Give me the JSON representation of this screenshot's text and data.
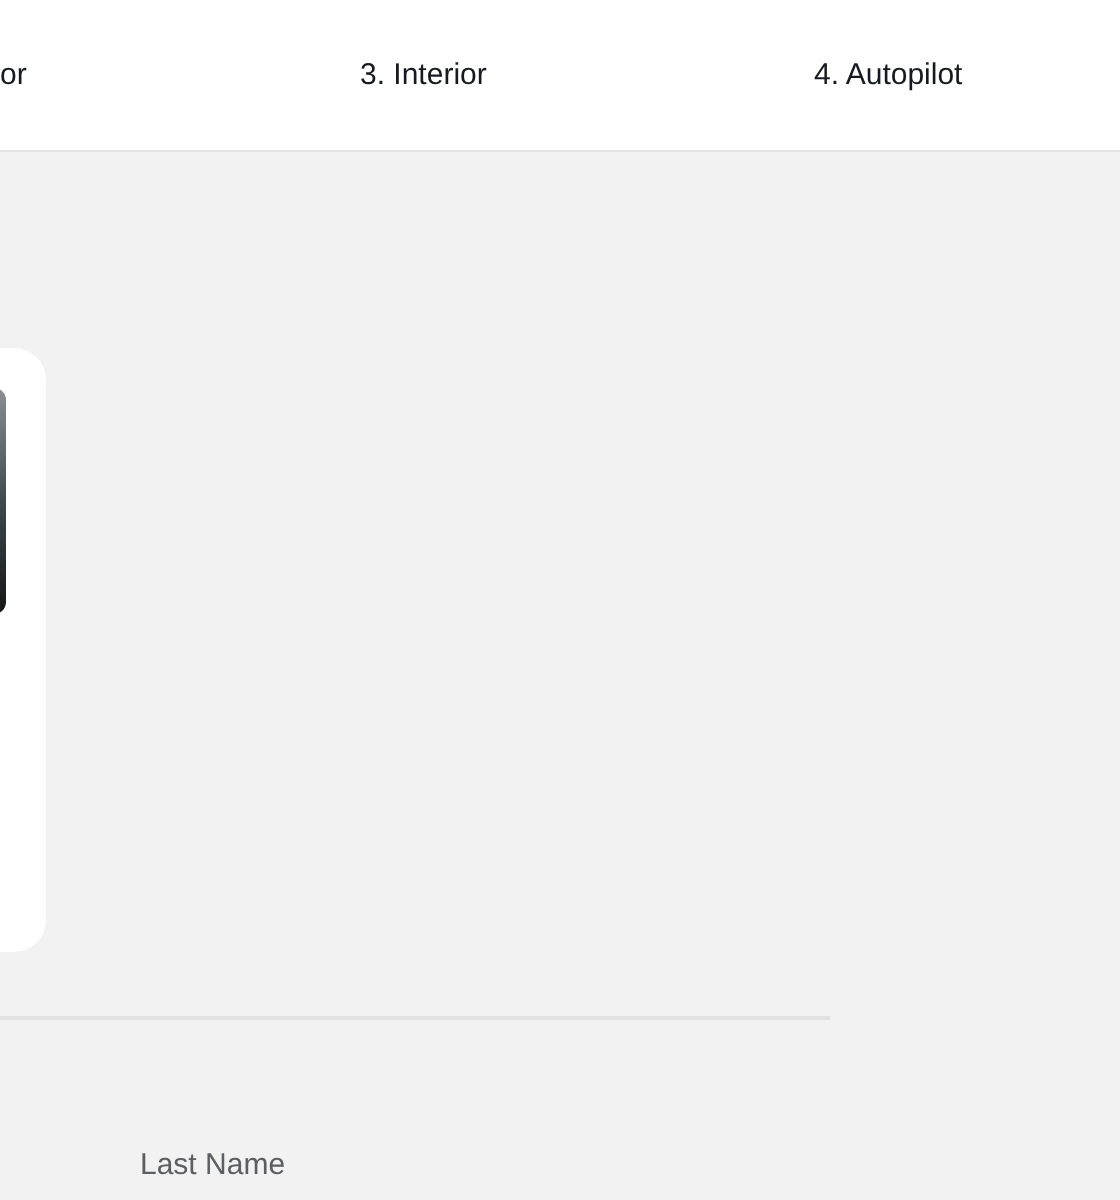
{
  "steps": [
    {
      "label": "or"
    },
    {
      "label": "3. Interior"
    },
    {
      "label": "4. Autopilot"
    }
  ],
  "form": {
    "last_name_label": "Last Name"
  }
}
